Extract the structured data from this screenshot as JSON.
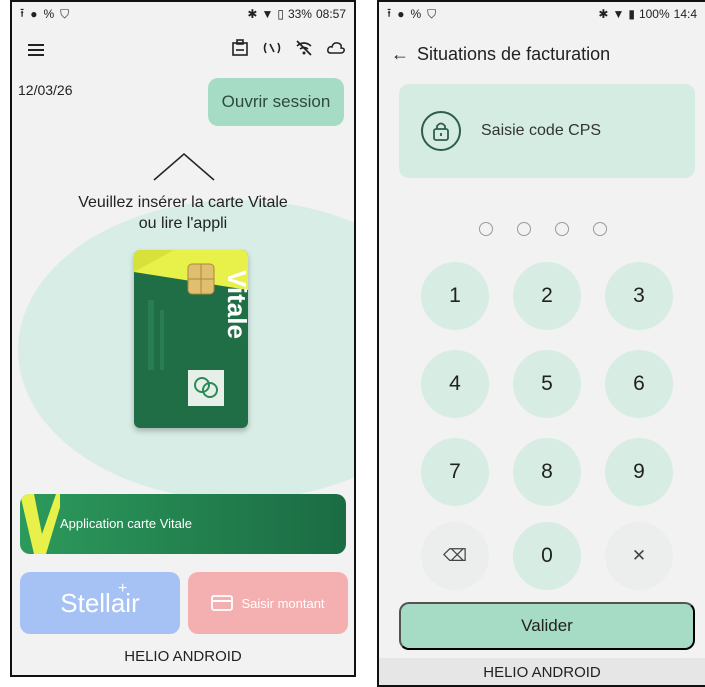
{
  "left": {
    "status": {
      "battery": "33%",
      "time": "08:57"
    },
    "date": "12/03/26",
    "open_session_label": "Ouvrir session",
    "prompt_line1": "Veuillez insérer la carte Vitale",
    "prompt_line2": "ou lire l'appli",
    "card_word": "Vitale",
    "app_vitale_label": "Application carte Vitale",
    "stellair_label": "Stellair",
    "saisir_label": "Saisir montant",
    "footer": "HELIO ANDROID"
  },
  "right": {
    "status": {
      "battery": "100%",
      "time": "14:4"
    },
    "title": "Situations de facturation",
    "cps_label": "Saisie code CPS",
    "keys": [
      "1",
      "2",
      "3",
      "4",
      "5",
      "6",
      "7",
      "8",
      "9",
      "0"
    ],
    "valider_label": "Valider",
    "footer": "HELIO ANDROID"
  },
  "colors": {
    "mint": "#a6dcc6",
    "mint_light": "#d7ece3",
    "green_dark": "#1b6b43",
    "vitale_yellow": "#e8f04a",
    "stellair_blue": "#a6c2f5",
    "saisir_pink": "#f4b0b0"
  },
  "icons": [
    "upload-icon",
    "face-icon",
    "bluetooth-icon",
    "wifi-icon",
    "battery-icon",
    "menu-icon",
    "card-reader-icon",
    "nfc-icon",
    "no-wifi-icon",
    "cloud-icon",
    "back-arrow-icon",
    "lock-icon",
    "backspace-icon",
    "clear-icon",
    "credit-card-icon"
  ]
}
